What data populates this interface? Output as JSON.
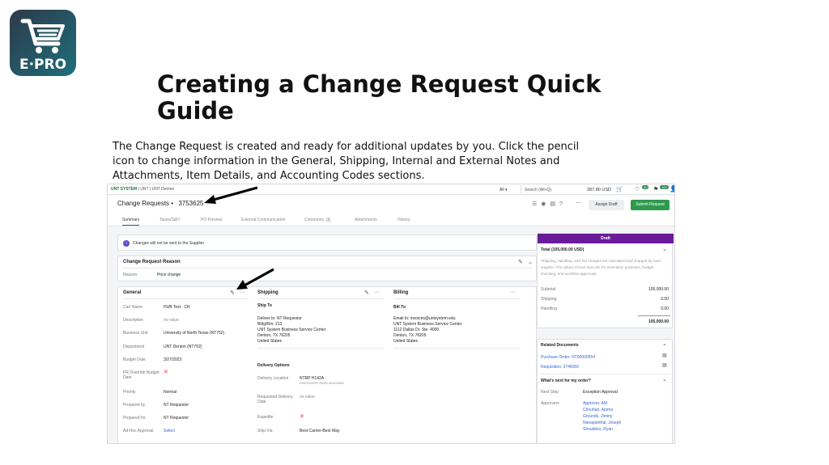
{
  "logo": {
    "text": "E·PRO"
  },
  "slide": {
    "title": "Creating a Change Request Quick Guide",
    "body": "The Change Request is created and ready for additional updates by you. Click the pencil icon to change information in the General, Shipping, Internal and External Notes and Attachments, Item Details, and Accounting Codes sections."
  },
  "app": {
    "topbar": {
      "brand_left": "UNT SYSTEM",
      "brand_mid": "UNT",
      "brand_right": "UNT Denton",
      "scope": "All",
      "search_placeholder": "Search (Alt+Q)",
      "cart_amount": "287.80 USD",
      "badge_a": "30",
      "badge_b": "162"
    },
    "request": {
      "title": "Change Requests",
      "separator": "•",
      "number": "3753625",
      "assign_button": "Assign Draft",
      "submit_button": "Submit Request",
      "more": "···"
    },
    "tabs": [
      {
        "label": "Summary"
      },
      {
        "label": "Taxes/S&H"
      },
      {
        "label": "PO Preview"
      },
      {
        "label": "External Communication"
      },
      {
        "label": "Comments",
        "count": "1"
      },
      {
        "label": "Attachments"
      },
      {
        "label": "History"
      }
    ],
    "notice": "Changes will not be sent to the Supplier",
    "reason_card": {
      "heading": "Change Request Reason",
      "label": "Reason",
      "value": "Price change"
    },
    "general": {
      "heading": "General",
      "rows": [
        {
          "label": "Cart Name",
          "value": "HUB Test - CR"
        },
        {
          "label": "Description",
          "value": "no value"
        },
        {
          "label": "Business Unit",
          "value": "University of North Texas (NT752)"
        },
        {
          "label": "Department",
          "value": "UNT Denton (NT752)"
        },
        {
          "label": "Budget Date",
          "value": "3/27/2023"
        },
        {
          "label": "PR Override Budget Date",
          "value": "✕"
        },
        {
          "label": "Priority",
          "value": "Normal"
        },
        {
          "label": "Prepared by",
          "value": "NT Requestor"
        },
        {
          "label": "Prepared for",
          "value": "NT Requestor"
        },
        {
          "label": "Ad-Hoc Approval",
          "value": "Select"
        }
      ]
    },
    "shipping": {
      "heading": "Shipping",
      "ship_to_label": "Ship To",
      "ship_to_lines": [
        "Deliver to: NT Requestor",
        "Bldg/Rm: 213",
        "UNT System Business Service Center",
        "Denton, TX 76205",
        "United States"
      ],
      "delivery_options_label": "Delivery Options",
      "rows": [
        {
          "label": "Delivery Location",
          "value": "NTRP H142A",
          "sub": "DISCOVERY PARK BUILDING"
        },
        {
          "label": "Requested Delivery Date",
          "value": "no value"
        },
        {
          "label": "Expedite",
          "value": "✕"
        },
        {
          "label": "Ship Via",
          "value": "Best Carrier-Best Way"
        }
      ]
    },
    "billing": {
      "heading": "Billing",
      "bill_to_label": "Bill To",
      "bill_to_lines": [
        "Email to: invoices@untsystem.edu",
        "UNT System Business Service Center",
        "1112 Dallas Dr. Ste. 4000",
        "Denton, TX 76205",
        "United States"
      ]
    },
    "summary_panel": {
      "status": "Draft",
      "total_label": "Total (105,000.00 USD)",
      "disclaimer": "Shipping, Handling, and Tax charges are calculated and charged by each supplier. The values shown here are for estimation purposes, budget checking, and workflow approvals.",
      "lines": [
        {
          "label": "Subtotal",
          "value": "105,000.00"
        },
        {
          "label": "Shipping",
          "value": "0.00"
        },
        {
          "label": "Handling",
          "value": "0.00"
        }
      ],
      "grand_total": "105,000.00"
    },
    "related_panel": {
      "heading": "Related Documents",
      "docs": [
        "Purchase Order: NT00000554",
        "Requisition: 3746066"
      ],
      "next_heading": "What's next for my order?",
      "next_step_label": "Next Step",
      "next_step_value": "Exception Approval",
      "approvers_label": "Approvers",
      "approvers": [
        "Approver, AM",
        "Chouhan, Apima",
        "Grounds, Jimmy",
        "Nanapanthal, Joseph",
        "Shoulders, Ryan"
      ]
    }
  }
}
